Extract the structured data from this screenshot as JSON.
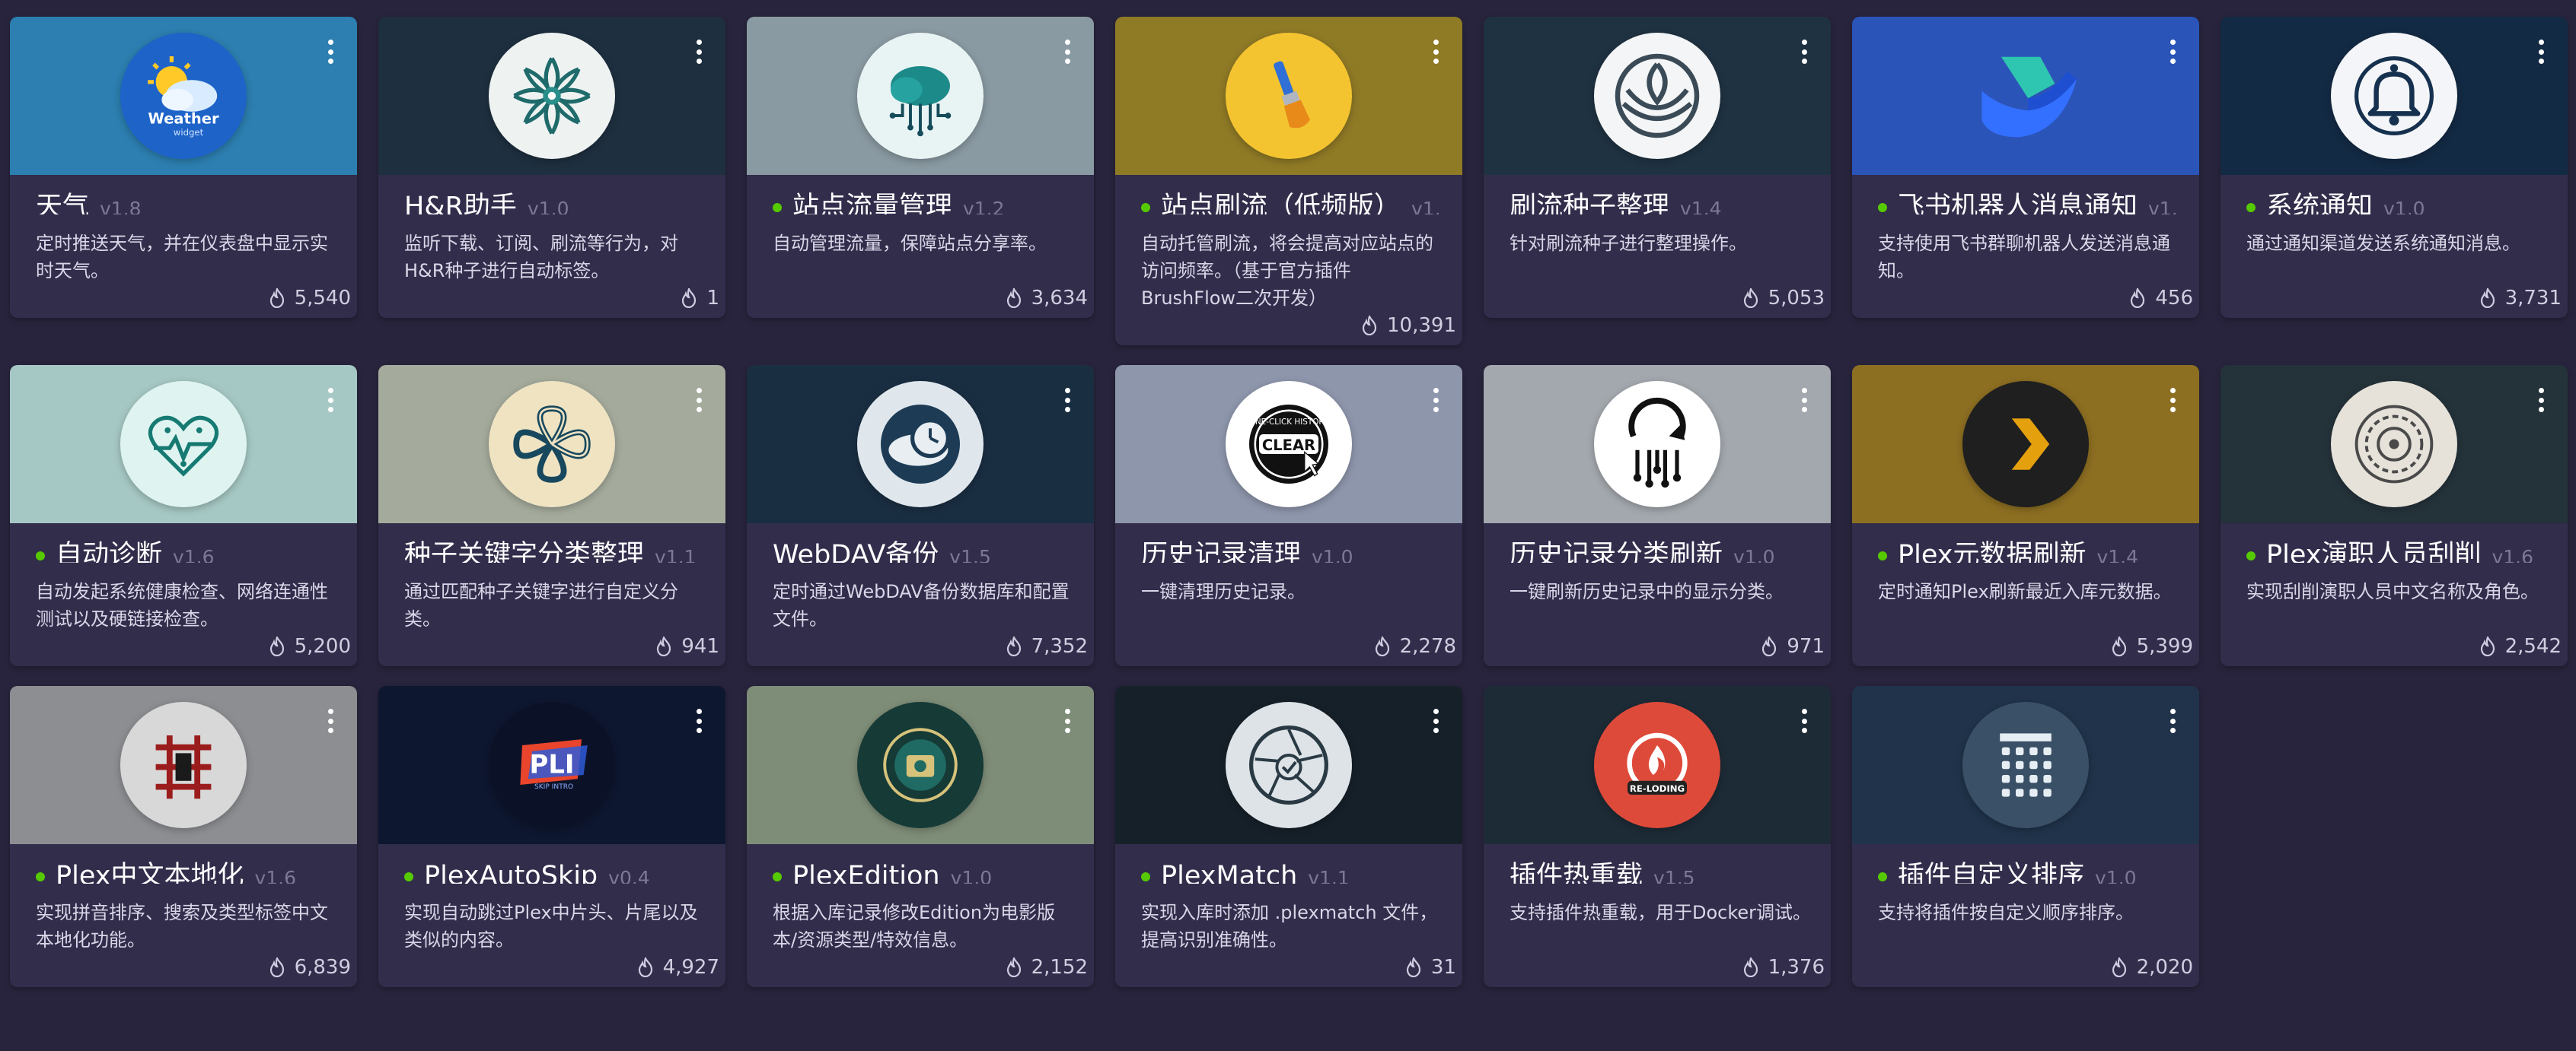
{
  "plugins": [
    {
      "name": "天气",
      "version": "v1.8",
      "enabled": false,
      "description": "定时推送天气，并在仪表盘中显示实时天气。",
      "downloads": "5,540",
      "icon": "weather-icon",
      "bg": "#2c7fb0",
      "logo_bg": "#1e63c8"
    },
    {
      "name": "H&R助手",
      "version": "v1.0",
      "enabled": false,
      "description": "监听下载、订阅、刷流等行为，对H&R种子进行自动标签。",
      "downloads": "1",
      "icon": "mandala-icon",
      "bg": "#1e2f3f",
      "logo_bg": "#eef3f2"
    },
    {
      "name": "站点流量管理",
      "version": "v1.2",
      "enabled": true,
      "description": "自动管理流量，保障站点分享率。",
      "downloads": "3,634",
      "icon": "cloud-circuit-icon",
      "bg": "#8a9aa2",
      "logo_bg": "#e8f4f4"
    },
    {
      "name": "站点刷流（低频版）",
      "version": "v1.",
      "enabled": true,
      "description": "自动托管刷流，将会提高对应站点的访问频率。（基于官方插件BrushFlow二次开发）",
      "downloads": "10,391",
      "icon": "paintbrush-icon",
      "bg": "#8f7a26",
      "logo_bg": "#f4c430"
    },
    {
      "name": "刷流种子整理",
      "version": "v1.4",
      "enabled": false,
      "description": "针对刷流种子进行整理操作。",
      "downloads": "5,053",
      "icon": "lotus-icon",
      "bg": "#1f3242",
      "logo_bg": "#f4f5f6"
    },
    {
      "name": "飞书机器人消息通知",
      "version": "v1.",
      "enabled": true,
      "description": "支持使用飞书群聊机器人发送消息通知。",
      "downloads": "456",
      "icon": "feishu-icon",
      "bg": "#2b54b8",
      "logo_bg": "transparent"
    },
    {
      "name": "系统通知",
      "version": "v1.0",
      "enabled": true,
      "description": "通过通知渠道发送系统通知消息。",
      "downloads": "3,731",
      "icon": "bell-icon",
      "bg": "#132a44",
      "logo_bg": "#f3f5f8"
    },
    {
      "name": "自动诊断",
      "version": "v1.6",
      "enabled": true,
      "description": "自动发起系统健康检查、网络连通性测试以及硬链接检查。",
      "downloads": "5,200",
      "icon": "heart-circuit-icon",
      "bg": "#a6c8c4",
      "logo_bg": "#dff4f1"
    },
    {
      "name": "种子关键字分类整理",
      "version": "v1.1",
      "enabled": false,
      "description": "通过匹配种子关键字进行自定义分类。",
      "downloads": "941",
      "icon": "knot-icon",
      "bg": "#a4ab9c",
      "logo_bg": "#efe3c2"
    },
    {
      "name": "WebDAV备份",
      "version": "v1.5",
      "enabled": false,
      "description": "定时通过WebDAV备份数据库和配置文件。",
      "downloads": "7,352",
      "icon": "cloud-clock-icon",
      "bg": "#1a2e42",
      "logo_bg": "#dfe7ec"
    },
    {
      "name": "历史记录清理",
      "version": "v1.0",
      "enabled": false,
      "description": "一键清理历史记录。",
      "downloads": "2,278",
      "icon": "clear-history-icon",
      "bg": "#8e96ac",
      "logo_bg": "#ffffff"
    },
    {
      "name": "历史记录分类刷新",
      "version": "v1.0",
      "enabled": false,
      "description": "一键刷新历史记录中的显示分类。",
      "downloads": "971",
      "icon": "refresh-circuit-icon",
      "bg": "#a3a8ae",
      "logo_bg": "#ffffff"
    },
    {
      "name": "Plex元数据刷新",
      "version": "v1.4",
      "enabled": true,
      "description": "定时通知Plex刷新最近入库元数据。",
      "downloads": "5,399",
      "icon": "plex-chevron-icon",
      "bg": "#8d6f22",
      "logo_bg": "#1f1f1f"
    },
    {
      "name": "Plex演职人员刮削",
      "version": "v1.6",
      "enabled": true,
      "description": "实现刮削演职人员中文名称及角色。",
      "downloads": "2,542",
      "icon": "film-reel-icon",
      "bg": "#24323a",
      "logo_bg": "#e6e2d9"
    },
    {
      "name": "Plex中文本地化",
      "version": "v1.6",
      "enabled": true,
      "description": "实现拼音排序、搜索及类型标签中文本地化功能。",
      "downloads": "6,839",
      "icon": "chinese-char-icon",
      "bg": "#8c8e92",
      "logo_bg": "#d8d8d8"
    },
    {
      "name": "PlexAutoSkip",
      "version": "v0.4",
      "enabled": true,
      "description": "实现自动跳过Plex中片头、片尾以及类似的内容。",
      "downloads": "4,927",
      "icon": "skip-intro-icon",
      "bg": "#0e1730",
      "logo_bg": "#0b1228"
    },
    {
      "name": "PlexEdition",
      "version": "v1.0",
      "enabled": true,
      "description": "根据入库记录修改Edition为电影版本/资源类型/特效信息。",
      "downloads": "2,152",
      "icon": "edition-badge-icon",
      "bg": "#7e8d78",
      "logo_bg": "#163a36"
    },
    {
      "name": "PlexMatch",
      "version": "v1.1",
      "enabled": true,
      "description": "实现入库时添加 .plexmatch 文件，提高识别准确性。",
      "downloads": "31",
      "icon": "aperture-check-icon",
      "bg": "#162029",
      "logo_bg": "#dde3e6"
    },
    {
      "name": "插件热重载",
      "version": "v1.5",
      "enabled": false,
      "description": "支持插件热重载，用于Docker调试。",
      "downloads": "1,376",
      "icon": "reload-flame-icon",
      "bg": "#1d2b36",
      "logo_bg": "#de4a3a"
    },
    {
      "name": "插件自定义排序",
      "version": "v1.0",
      "enabled": true,
      "description": "支持将插件按自定义顺序排序。",
      "downloads": "2,020",
      "icon": "sort-grid-icon",
      "bg": "#20334a",
      "logo_bg": "#3a5066"
    }
  ],
  "colors": {
    "page_bg": "#28243d",
    "card_bg": "#312d4b",
    "enabled_dot": "#56ca00",
    "version_text": "#7d7896"
  }
}
